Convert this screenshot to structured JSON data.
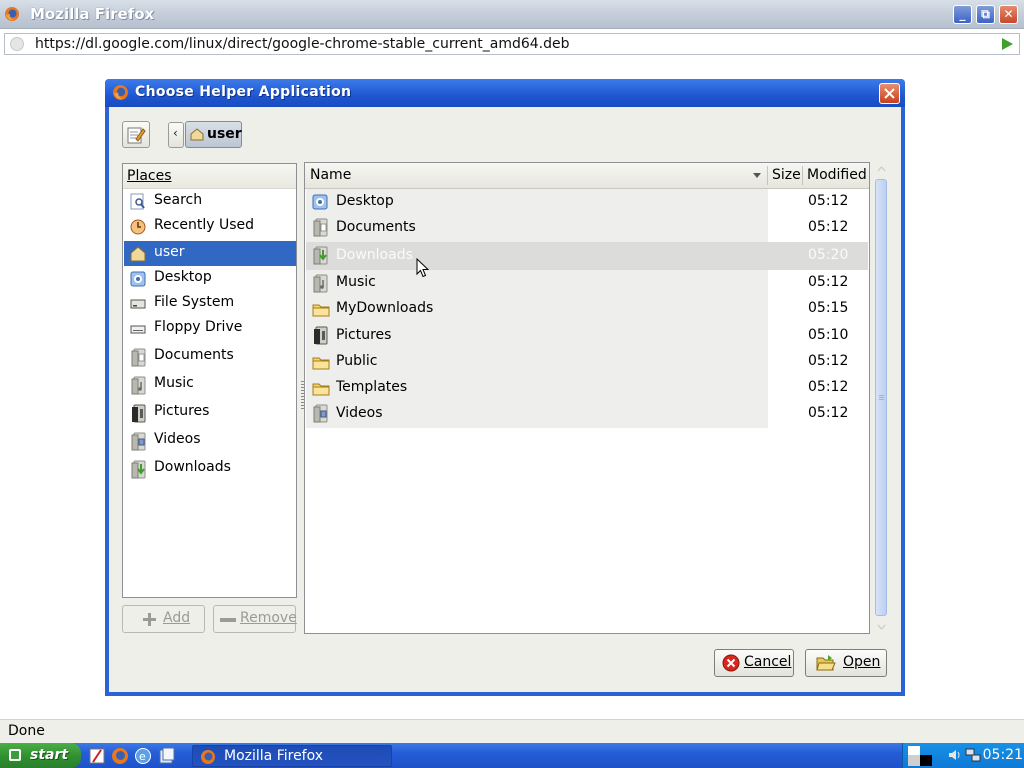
{
  "window": {
    "title": "Mozilla Firefox",
    "icon": "firefox-icon",
    "url": "https://dl.google.com/linux/direct/google-chrome-stable_current_amd64.deb",
    "status_text": "Done"
  },
  "dialog": {
    "title": "Choose Helper Application",
    "breadcrumb": [
      "user"
    ],
    "places_header": "Places",
    "places": [
      {
        "label": "Search",
        "icon": "search-icon"
      },
      {
        "label": "Recently Used",
        "icon": "recent-icon"
      },
      {
        "label": "user",
        "icon": "home-icon",
        "selected": true
      },
      {
        "label": "Desktop",
        "icon": "desktop-icon"
      },
      {
        "label": "File System",
        "icon": "drive-icon"
      },
      {
        "label": "Floppy Drive",
        "icon": "floppy-icon"
      },
      {
        "label": "Documents",
        "icon": "documents-folder-icon"
      },
      {
        "label": "Music",
        "icon": "music-folder-icon"
      },
      {
        "label": "Pictures",
        "icon": "pictures-folder-icon"
      },
      {
        "label": "Videos",
        "icon": "videos-folder-icon"
      },
      {
        "label": "Downloads",
        "icon": "downloads-folder-icon"
      }
    ],
    "add_label": "Add",
    "remove_label": "Remove",
    "columns": {
      "name": "Name",
      "size": "Size",
      "modified": "Modified"
    },
    "files": [
      {
        "name": "Desktop",
        "modified": "05:12",
        "icon": "desktop-icon"
      },
      {
        "name": "Documents",
        "modified": "05:12",
        "icon": "documents-folder-icon"
      },
      {
        "name": "Downloads",
        "modified": "05:20",
        "icon": "downloads-folder-icon",
        "hover": true
      },
      {
        "name": "Music",
        "modified": "05:12",
        "icon": "music-folder-icon"
      },
      {
        "name": "MyDownloads",
        "modified": "05:15",
        "icon": "folder-icon"
      },
      {
        "name": "Pictures",
        "modified": "05:10",
        "icon": "pictures-folder-icon"
      },
      {
        "name": "Public",
        "modified": "05:12",
        "icon": "folder-icon"
      },
      {
        "name": "Templates",
        "modified": "05:12",
        "icon": "folder-icon"
      },
      {
        "name": "Videos",
        "modified": "05:12",
        "icon": "videos-folder-icon"
      }
    ],
    "cancel_label": "Cancel",
    "open_label": "Open"
  },
  "taskbar": {
    "start_label": "start",
    "task_label": "Mozilla Firefox",
    "clock": "05:21"
  },
  "colors": {
    "dialog_title_blue": "#2a63d6",
    "selection_blue": "#3168c4",
    "taskbar_blue": "#245dd8",
    "start_green": "#3a9e3a"
  }
}
